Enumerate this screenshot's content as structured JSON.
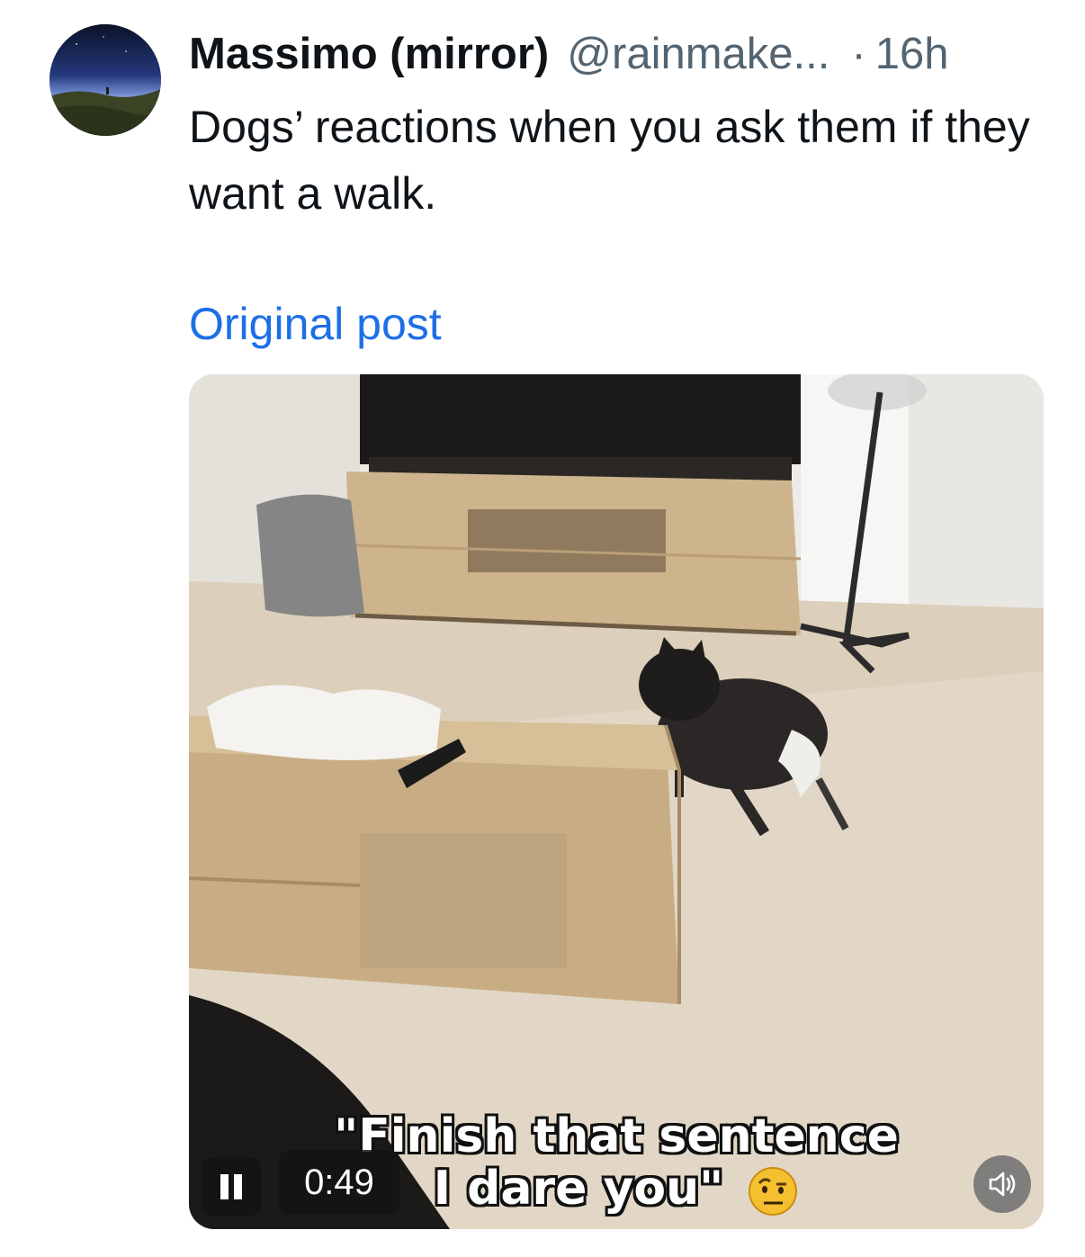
{
  "author": {
    "name": "Massimo (mirror)",
    "handle": "@rainmake...",
    "separator": "·",
    "time": "16h",
    "avatar_icon": "avatar-night-sky-icon"
  },
  "post": {
    "text": "Dogs’ reactions when you ask them if they want a walk.",
    "original_link": "Original post"
  },
  "video": {
    "caption_line_1": "\"Finish that sentence",
    "caption_line_2": "I dare you\"",
    "emoji_icon": "raised-eyebrow-emoji",
    "time_remaining": "0:49",
    "pause_icon": "pause-icon",
    "sound_icon": "speaker-icon"
  },
  "colors": {
    "text_primary": "#0f1419",
    "text_secondary": "#536471",
    "link": "#1d6fe6"
  }
}
